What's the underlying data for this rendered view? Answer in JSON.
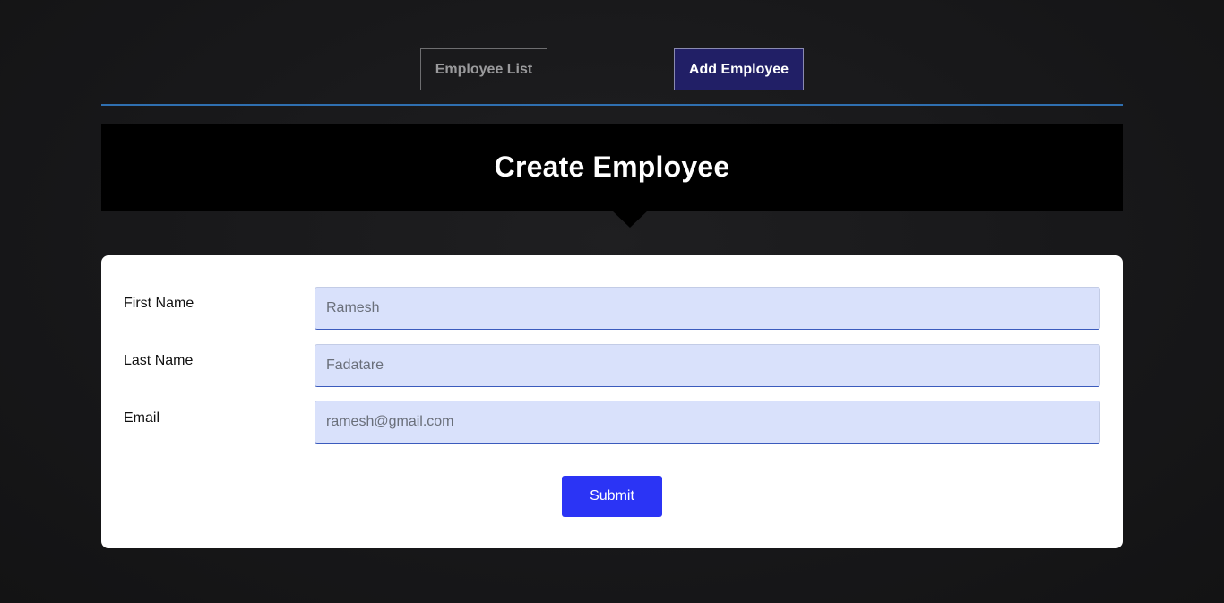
{
  "nav": {
    "employee_list_label": "Employee List",
    "add_employee_label": "Add Employee"
  },
  "banner": {
    "title": "Create Employee"
  },
  "form": {
    "first_name": {
      "label": "First Name",
      "placeholder": "Ramesh",
      "value": ""
    },
    "last_name": {
      "label": "Last Name",
      "placeholder": "Fadatare",
      "value": ""
    },
    "email": {
      "label": "Email",
      "placeholder": "ramesh@gmail.com",
      "value": ""
    },
    "submit_label": "Submit"
  },
  "colors": {
    "background": "#18181a",
    "active_nav": "#211f66",
    "nav_divider": "#2f6fb0",
    "banner": "#000000",
    "input_bg": "#d9e1fb",
    "submit": "#2b34f5"
  }
}
